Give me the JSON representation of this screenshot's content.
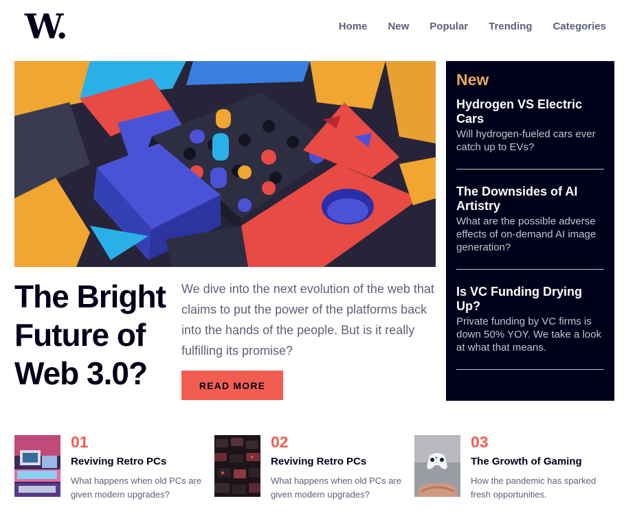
{
  "brand": {
    "logo_text": "W."
  },
  "nav": {
    "items": [
      {
        "label": "Home"
      },
      {
        "label": "New"
      },
      {
        "label": "Popular"
      },
      {
        "label": "Trending"
      },
      {
        "label": "Categories"
      }
    ]
  },
  "hero": {
    "title": "The Bright Future of Web 3.0?",
    "description": "We dive into the next evolution of the web that claims to put the power of the platforms back into the hands of the people. But is it really fulfilling its promise?",
    "button_label": "READ MORE"
  },
  "new_panel": {
    "heading": "New",
    "items": [
      {
        "title": "Hydrogen VS Electric Cars",
        "text": "Will hydrogen-fueled cars ever catch up to EVs?"
      },
      {
        "title": "The Downsides of AI Artistry",
        "text": "What are the possible adverse effects of on-demand AI image generation?"
      },
      {
        "title": "Is VC Funding Drying Up?",
        "text": "Private funding by VC firms is down 50% YOY. We take a look at what that means."
      }
    ]
  },
  "articles": [
    {
      "number": "01",
      "title": "Reviving Retro PCs",
      "text": "What happens when old PCs are given modern upgrades?"
    },
    {
      "number": "02",
      "title": "Reviving Retro PCs",
      "text": "What happens when old PCs are given modern upgrades?"
    },
    {
      "number": "03",
      "title": "The Growth of Gaming",
      "text": "How the pandemic has sparked fresh opportunities."
    }
  ],
  "colors": {
    "dark_navy": "#00001a",
    "soft_orange": "#e9ab53",
    "soft_red": "#f15e50",
    "grayish_blue": "#5d5f79",
    "off_white": "#fffdfa"
  }
}
